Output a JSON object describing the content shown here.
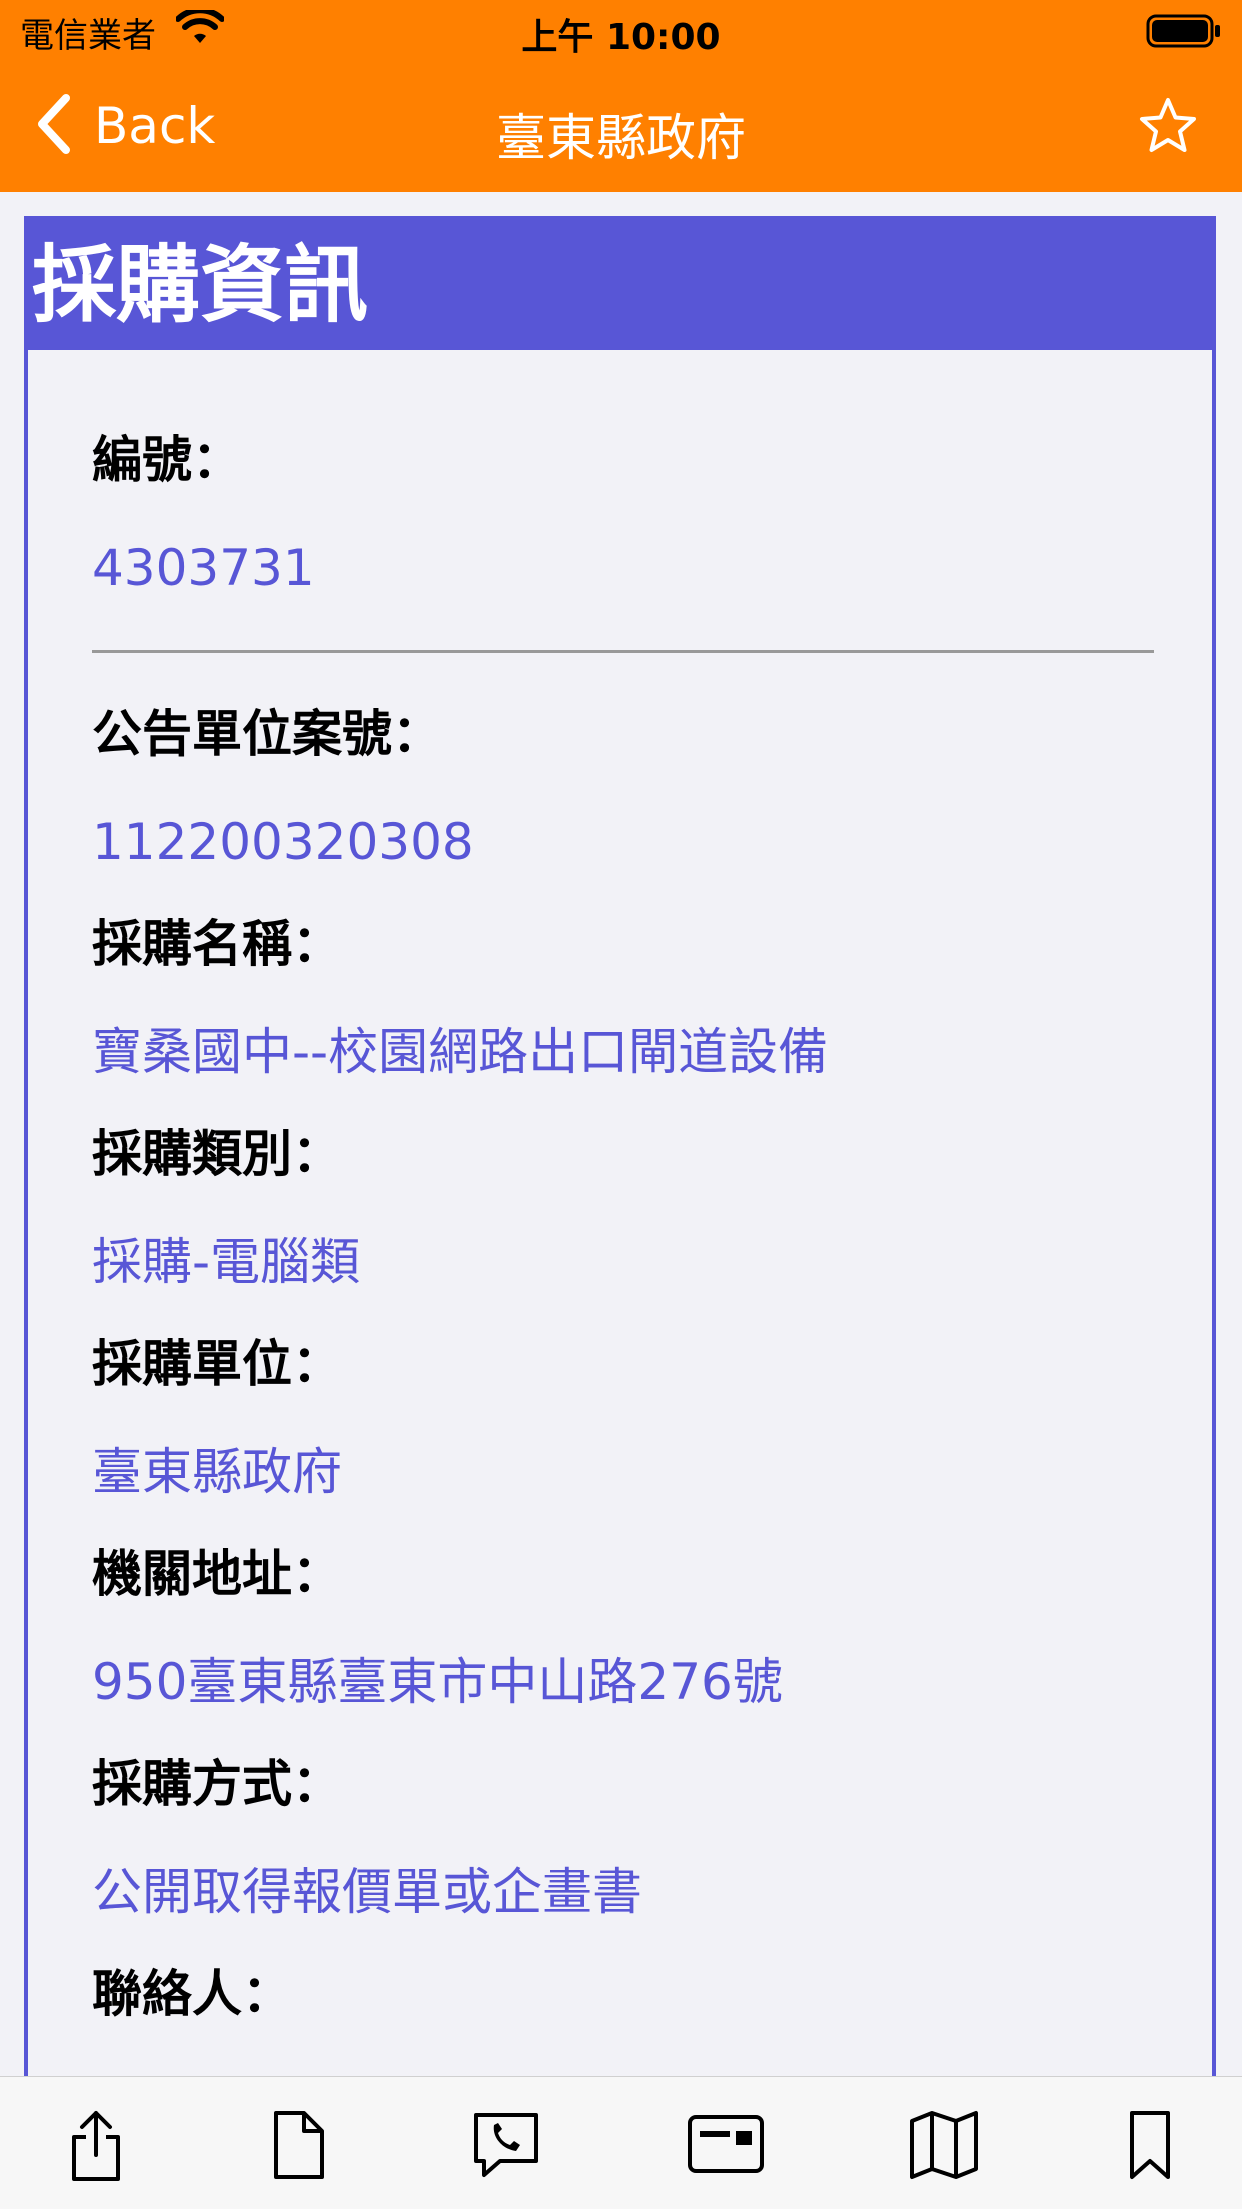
{
  "status_bar": {
    "carrier": "電信業者",
    "time": "上午 10:00"
  },
  "nav": {
    "back_label": "Back",
    "title": "臺東縣政府"
  },
  "card": {
    "header": "採購資訊",
    "fields": [
      {
        "label": "編號：",
        "value": "4303731"
      },
      {
        "label": "公告單位案號：",
        "value": "112200320308"
      },
      {
        "label": "採購名稱：",
        "value": "寶桑國中--校園網路出口閘道設備"
      },
      {
        "label": "採購類別：",
        "value": "採購-電腦類"
      },
      {
        "label": "採購單位：",
        "value": "臺東縣政府"
      },
      {
        "label": "機關地址：",
        "value": "950臺東縣臺東市中山路276號"
      },
      {
        "label": "採購方式：",
        "value": "公開取得報價單或企畫書"
      },
      {
        "label": "聯絡人：",
        "value": ""
      }
    ]
  },
  "tabbar": {
    "icons": [
      "share-icon",
      "document-icon",
      "phone-icon",
      "card-icon",
      "map-icon",
      "bookmark-icon"
    ]
  }
}
